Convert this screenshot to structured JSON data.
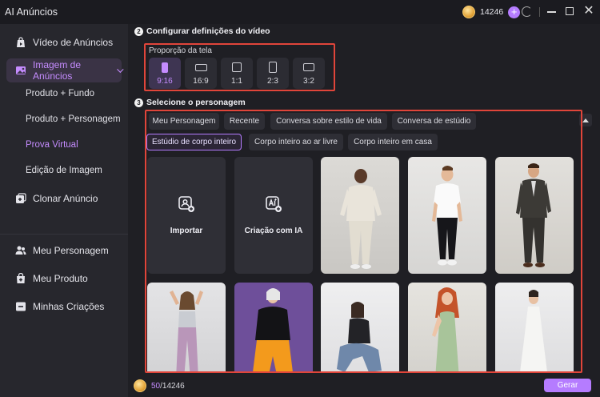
{
  "app": {
    "title": "AI Anúncios",
    "credits": "14246",
    "plus": "+"
  },
  "sidebar": {
    "items": [
      {
        "label": "Vídeo de Anúncios"
      },
      {
        "label": "Imagem de Anúncios"
      },
      {
        "label": "Clonar Anúncio"
      },
      {
        "label": "Meu Personagem"
      },
      {
        "label": "Meu Produto"
      },
      {
        "label": "Minhas Criações"
      }
    ],
    "subitems": [
      {
        "label": "Produto + Fundo"
      },
      {
        "label": "Produto + Personagem"
      },
      {
        "label": "Prova Virtual"
      },
      {
        "label": "Edição de Imagem"
      }
    ]
  },
  "step2": {
    "number": "2",
    "title": "Configurar definições do vídeo",
    "ratio_label": "Proporção da tela",
    "ratios": [
      "9:16",
      "16:9",
      "1:1",
      "2:3",
      "3:2"
    ],
    "selected_ratio": "9:16"
  },
  "step3": {
    "number": "3",
    "title": "Selecione o personagem",
    "tabs_row1": [
      "Meu Personagem",
      "Recente",
      "Conversa sobre estilo de vida",
      "Conversa de estúdio"
    ],
    "tabs_row2": [
      "Estúdio de corpo inteiro",
      "Corpo inteiro ao ar livre",
      "Corpo inteiro em casa"
    ],
    "selected_tab": "Estúdio de corpo inteiro",
    "actions": [
      "Importar",
      "Criação com IA"
    ]
  },
  "footer": {
    "cost": "50",
    "total": "/14246",
    "generate_label": "Gerar"
  },
  "colors": {
    "accent": "#b57cff",
    "highlight_border": "#e0453a",
    "background": "#1f1f24",
    "sidebar": "#27272d"
  }
}
